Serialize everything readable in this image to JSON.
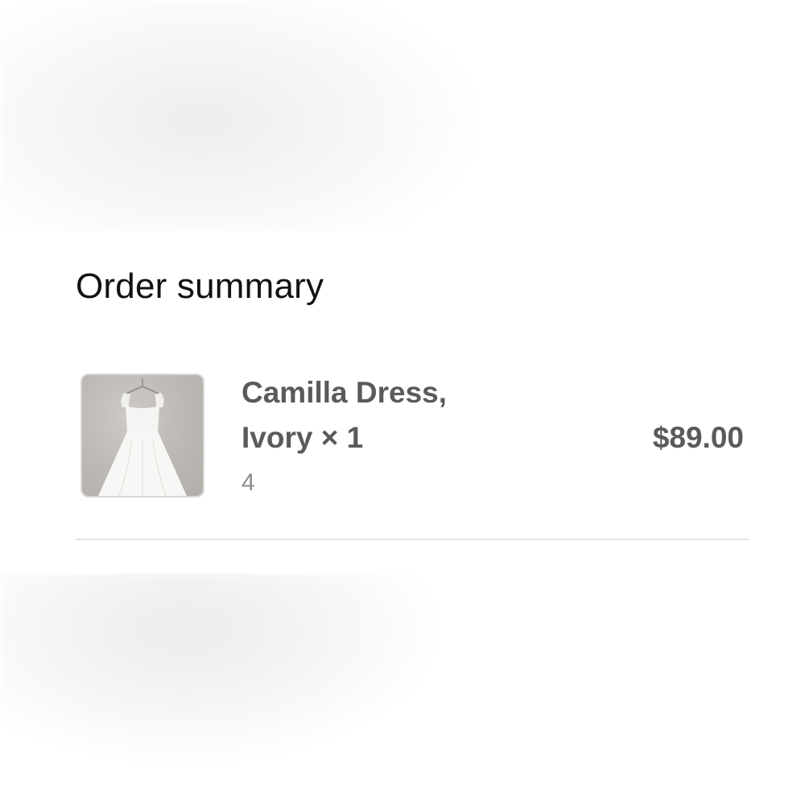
{
  "order_summary": {
    "title": "Order summary",
    "items": [
      {
        "name_line1": "Camilla Dress,",
        "name_line2": "Ivory × 1",
        "variant": "4",
        "price": "$89.00",
        "image_icon": "dress-product-image"
      }
    ]
  },
  "colors": {
    "title_text": "#121212",
    "item_text": "#5a5a5a",
    "variant_text": "#8c8c8c",
    "divider": "#e3e3e3",
    "background": "#ffffff"
  }
}
